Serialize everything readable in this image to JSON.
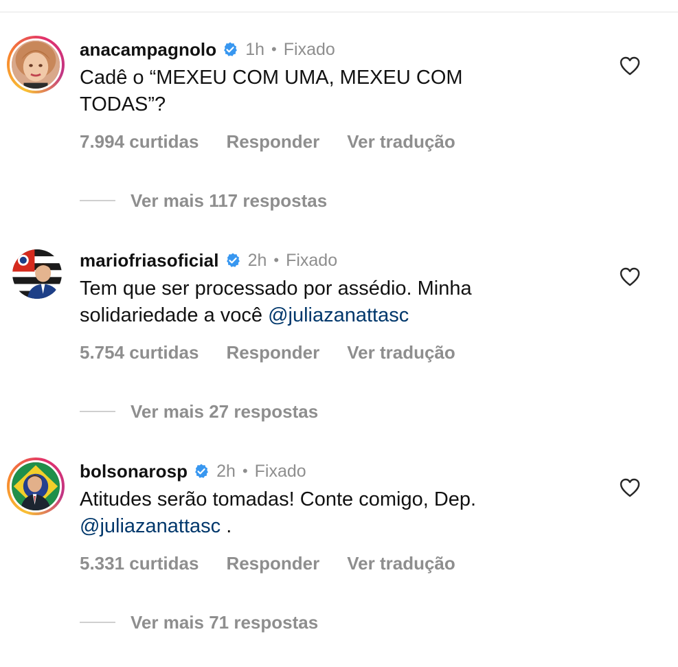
{
  "comments": [
    {
      "username": "anacampagnolo",
      "time": "1h",
      "separator": "•",
      "pinned": "Fixado",
      "text_lines": [
        "Cadê o “MEXEU COM UMA, MEXEU COM",
        "TODAS”?"
      ],
      "likes": "7.994 curtidas",
      "reply": "Responder",
      "translate": "Ver tradução",
      "more_replies": "Ver mais 117 respostas",
      "avatar_icon": "avatar-woman",
      "has_story_ring": true
    },
    {
      "username": "mariofriasoficial",
      "time": "2h",
      "separator": "•",
      "pinned": "Fixado",
      "text_line1": "Tem que ser processado por assédio. Minha",
      "text_line2_prefix": "solidariedade a você ",
      "text_line2_mention": "@juliazanattasc",
      "likes": "5.754 curtidas",
      "reply": "Responder",
      "translate": "Ver tradução",
      "more_replies": "Ver mais 27 respostas",
      "avatar_icon": "avatar-man-flag",
      "has_story_ring": false
    },
    {
      "username": "bolsonarosp",
      "time": "2h",
      "separator": "•",
      "pinned": "Fixado",
      "text_line1": "Atitudes serão tomadas! Conte comigo, Dep.",
      "text_line2_mention": "@juliazanattasc",
      "text_line2_suffix": " .",
      "likes": "5.331 curtidas",
      "reply": "Responder",
      "translate": "Ver tradução",
      "more_replies": "Ver mais 71 respostas",
      "avatar_icon": "avatar-man-suit",
      "has_story_ring": true
    }
  ],
  "colors": {
    "text": "#111111",
    "muted": "#8e8e8e",
    "mention": "#00376b",
    "verified": "#3897f0"
  }
}
